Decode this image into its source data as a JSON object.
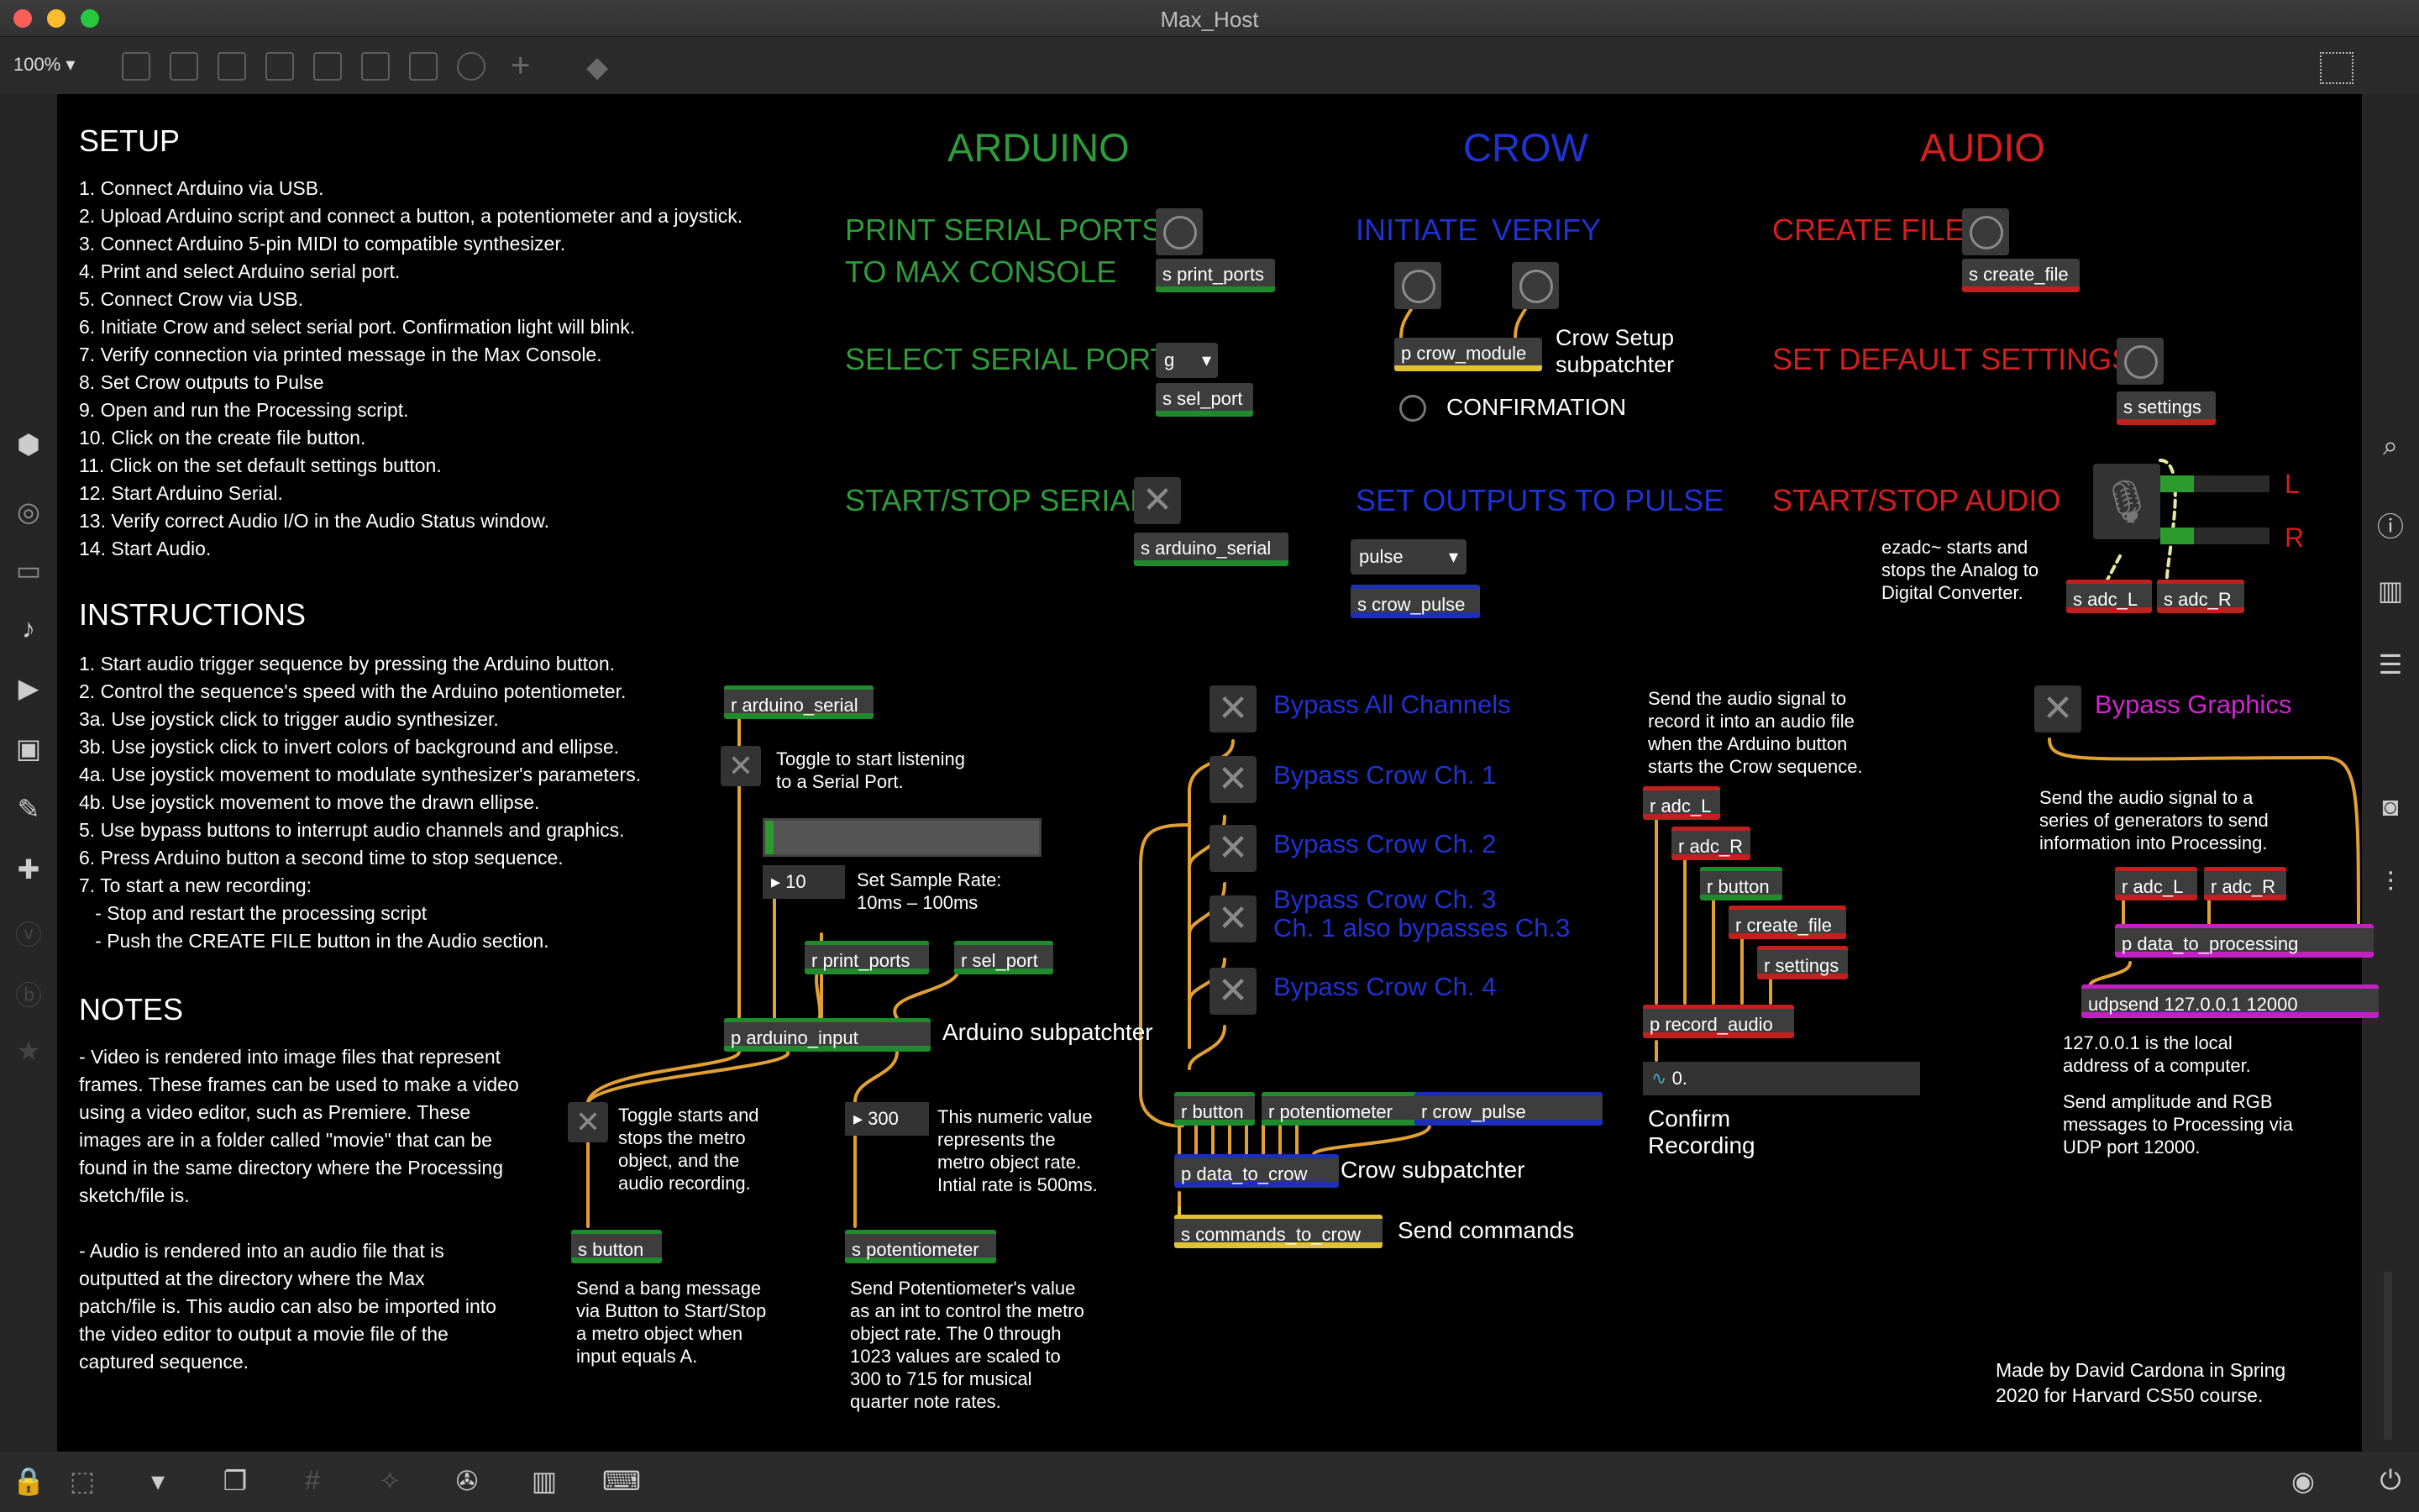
{
  "window": {
    "title": "Max_Host",
    "zoom": "100%"
  },
  "setup": {
    "heading": "SETUP",
    "lines": [
      "1. Connect Arduino via USB.",
      "2. Upload Arduino script and connect a button, a potentiometer and a joystick.",
      "3. Connect Arduino 5-pin MIDI to compatible synthesizer.",
      "4. Print and select Arduino serial port.",
      "5. Connect Crow via USB.",
      "6. Initiate Crow and select serial port. Confirmation light will blink.",
      "7. Verify connection via printed message in the Max Console.",
      "8. Set Crow outputs to Pulse",
      "9. Open and run the Processing script.",
      "10. Click on the create file button.",
      "11. Click on the set default settings button.",
      "12. Start Arduino Serial.",
      "13. Verify correct Audio I/O in the Audio Status window.",
      "14. Start Audio."
    ]
  },
  "instructions": {
    "heading": "INSTRUCTIONS",
    "lines": [
      "1. Start audio trigger sequence by pressing the Arduino button.",
      "2. Control the sequence's speed with the Arduino potentiometer.",
      "3a. Use joystick click to trigger audio synthesizer.",
      "3b. Use joystick click to invert colors of background and ellipse.",
      "4a. Use joystick movement to modulate synthesizer's parameters.",
      "4b. Use joystick movement to move the drawn ellipse.",
      "5. Use bypass buttons to interrupt audio channels and graphics.",
      "6. Press Arduino button a second time to stop sequence.",
      "7. To start a new recording:",
      "   - Stop and restart the processing script",
      "   - Push the CREATE FILE button in the Audio section."
    ]
  },
  "notes": {
    "heading": "NOTES",
    "lines": [
      "- Video is rendered into image files that represent",
      "frames. These frames can be used to make a video",
      "using a video editor, such as Premiere. These",
      "images are in a folder called \"movie\" that can be",
      "found in the same directory where the Processing",
      "sketch/file is.",
      "",
      "- Audio is rendered into an audio file that is",
      "outputted at the directory where the Max",
      "patch/file is. This audio can also be imported into",
      "the video editor to output a movie file of the",
      "captured sequence."
    ]
  },
  "arduino": {
    "title": "ARDUINO",
    "print_ports_1": "PRINT SERIAL PORTS",
    "print_ports_2": "TO MAX CONSOLE",
    "select_port": "SELECT SERIAL PORT",
    "start_stop": "START/STOP SERIAL",
    "port_value": "g",
    "s_print_ports": "s print_ports",
    "s_sel_port": "s sel_port",
    "s_arduino_serial": "s arduino_serial"
  },
  "crow": {
    "title": "CROW",
    "initiate": "INITIATE",
    "verify": "VERIFY",
    "p_crow_module": "p crow_module",
    "setup_note_1": "Crow Setup",
    "setup_note_2": "subpatchter",
    "confirmation": "CONFIRMATION",
    "set_outputs": "SET OUTPUTS TO PULSE",
    "pulse_value": "pulse",
    "s_crow_pulse": "s crow_pulse"
  },
  "audio": {
    "title": "AUDIO",
    "create_file": "CREATE FILE",
    "s_create_file": "s create_file",
    "set_default": "SET DEFAULT SETTINGS",
    "s_settings": "s settings",
    "start_stop": "START/STOP AUDIO",
    "L": "L",
    "R": "R",
    "ezadc_note": [
      "ezadc~ starts and",
      "stops the Analog to",
      "Digital Converter."
    ],
    "s_adc_L": "s adc_L",
    "s_adc_R": "s adc_R"
  },
  "serial_section": {
    "r_arduino_serial": "r arduino_serial",
    "toggle_note": [
      "Toggle to start listening",
      "to a Serial Port."
    ],
    "rate_value": "10",
    "rate_note": [
      "Set Sample Rate:",
      "10ms – 100ms"
    ],
    "r_print_ports": "r print_ports",
    "r_sel_port": "r sel_port",
    "p_arduino_input": "p arduino_input",
    "arduino_subpatcher": "Arduino subpatchter",
    "toggle2_note": [
      "Toggle starts and",
      "stops the metro",
      "object, and the",
      "audio recording."
    ],
    "metro_value": "300",
    "metro_note": [
      "This numeric value",
      "represents the",
      "metro object rate.",
      "Intial rate is 500ms."
    ],
    "s_button": "s button",
    "s_potentiometer": "s potentiometer",
    "button_note": [
      "Send a bang message",
      "via Button to Start/Stop",
      "a metro object when",
      "input equals A."
    ],
    "pot_note": [
      "Send Potentiometer's value",
      "as an int to control the metro",
      "object rate. The 0 through",
      "1023 values are scaled to",
      "300 to 715 for musical",
      "quarter note rates."
    ]
  },
  "bypass": {
    "all": "Bypass All Channels",
    "ch1": "Bypass Crow Ch. 1",
    "ch2": "Bypass Crow Ch. 2",
    "ch3a": "Bypass Crow Ch. 3",
    "ch3b": "Ch. 1 also bypasses Ch.3",
    "ch4": "Bypass Crow Ch. 4",
    "r_button": "r button",
    "r_potentiometer": "r potentiometer",
    "r_crow_pulse": "r crow_pulse",
    "p_data_to_crow": "p data_to_crow",
    "crow_subpatcher": "Crow subpatchter",
    "s_commands_to_crow": "s commands_to_crow",
    "send_commands": "Send commands"
  },
  "record": {
    "note": [
      "Send the audio signal to",
      "record it into an audio file",
      "when the Arduino button",
      "starts the Crow sequence."
    ],
    "r_adc_L": "r adc_L",
    "r_adc_R": "r adc_R",
    "r_button": "r button",
    "r_create_file": "r create_file",
    "r_settings": "r settings",
    "p_record_audio": "p record_audio",
    "signal_value": "0.",
    "confirm": [
      "Confirm",
      "Recording"
    ]
  },
  "graphics": {
    "bypass": "Bypass Graphics",
    "note": [
      "Send the audio signal to a",
      "series of generators to send",
      "information into Processing."
    ],
    "r_adc_L": "r adc_L",
    "r_adc_R": "r adc_R",
    "p_data_to_processing": "p data_to_processing",
    "udpsend": "udpsend 127.0.0.1 12000",
    "local_note": [
      "127.0.0.1 is the local",
      "address of a computer."
    ],
    "send_note": [
      "Send amplitude and RGB",
      "messages to Processing via",
      "UDP port 12000."
    ]
  },
  "credit": [
    "Made by David Cardona in Spring",
    "2020 for Harvard CS50 course."
  ],
  "colors": {
    "arduino": "#2f9b3a",
    "crow": "#1f32d4",
    "audio": "#d31f1f",
    "graphics": "#d126d1",
    "cord": "#e0a033"
  }
}
